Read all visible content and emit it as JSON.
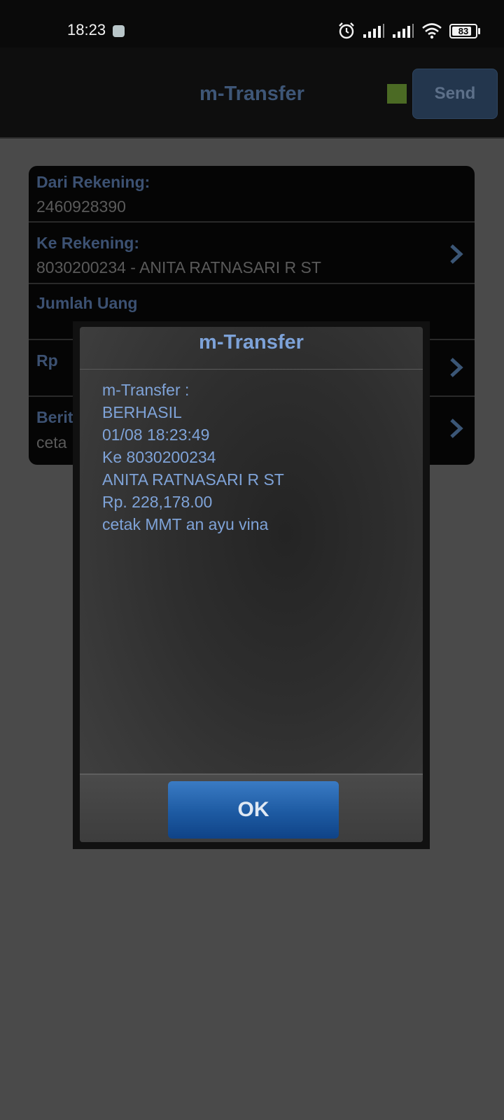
{
  "status_bar": {
    "time": "18:23",
    "battery": "83",
    "battery_level": 0.83,
    "icons": [
      "alarm-icon",
      "signal-icon",
      "signal-icon",
      "wifi-icon",
      "battery-icon"
    ]
  },
  "header": {
    "title": "m-Transfer",
    "send_label": "Send",
    "indicator_color": "#4b6a24"
  },
  "form": {
    "rows": [
      {
        "label": "Dari Rekening:",
        "value": "2460928390"
      },
      {
        "label": "Ke Rekening:",
        "value": "8030200234 - ANITA RATNASARI R ST"
      },
      {
        "label": "Jumlah Uang",
        "value": ""
      },
      {
        "label": "Rp",
        "value": ""
      },
      {
        "label": "Berit",
        "value": "ceta"
      }
    ]
  },
  "dialog": {
    "title": "m-Transfer",
    "lines": [
      "m-Transfer :",
      "BERHASIL",
      "01/08 18:23:49",
      "Ke 8030200234",
      "ANITA RATNASARI R ST",
      "Rp. 228,178.00",
      "cetak MMT an ayu vina"
    ],
    "ok_label": "OK"
  },
  "colors": {
    "accent": "#7da2d8",
    "button": "#1d5aa2"
  }
}
